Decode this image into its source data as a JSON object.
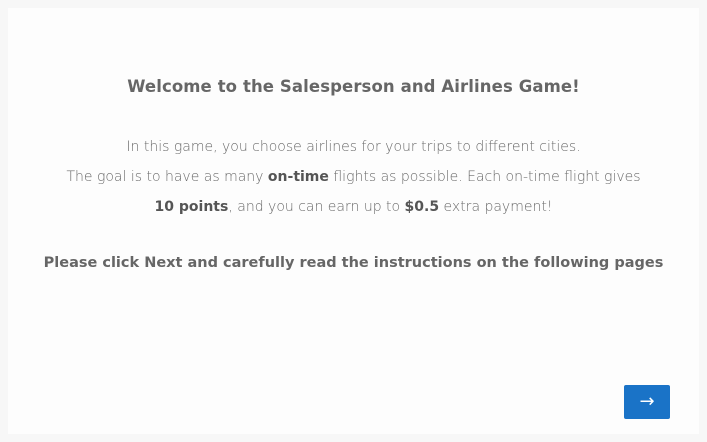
{
  "welcome": {
    "title": "Welcome to the Salesperson and Airlines Game!",
    "line1": "In this game, you choose airlines for your trips to different cities.",
    "line2_pre": "The goal is to have as many ",
    "line2_bold": "on-time",
    "line2_post": " flights as possible. Each on-time flight gives",
    "line3_bold1": "10 points",
    "line3_mid": ", and you can earn up to ",
    "line3_bold2": "$0.5",
    "line3_post": " extra payment!",
    "instruction": "Please click Next and carefully read the instructions on the following pages"
  },
  "navigation": {
    "next_label": "→",
    "next_icon": "arrow-right-icon"
  },
  "colors": {
    "button_bg": "#1a73c7",
    "text": "#666666"
  }
}
